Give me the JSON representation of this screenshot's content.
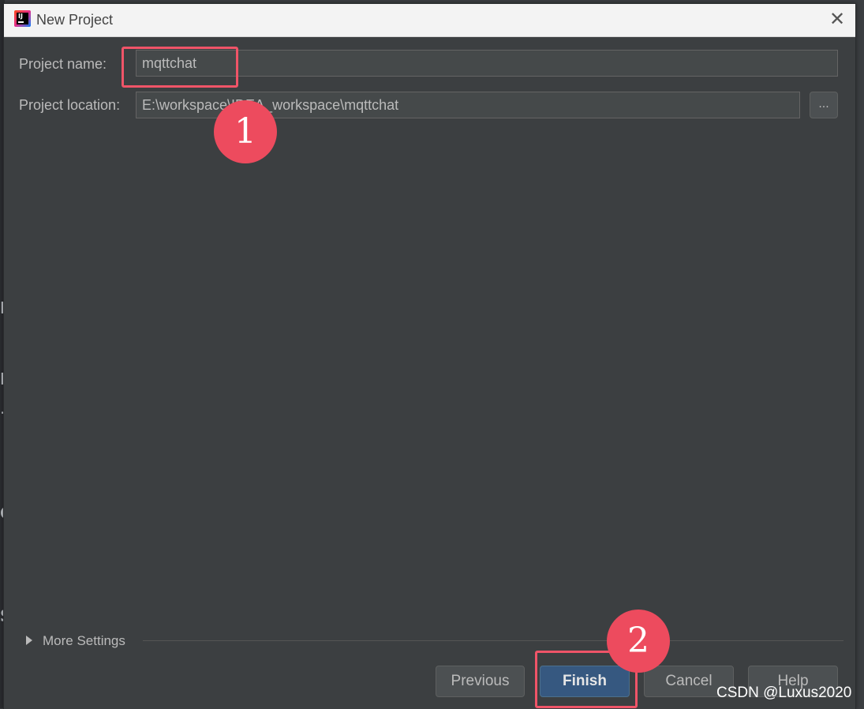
{
  "dialog": {
    "title": "New Project",
    "close_icon": "close-icon"
  },
  "form": {
    "project_name_label": "Project name:",
    "project_name_value": "mqttchat",
    "project_location_label": "Project location:",
    "project_location_value": "E:\\workspace\\IDEA_workspace\\mqttchat",
    "browse_label": "..."
  },
  "more_settings": {
    "label": "More Settings"
  },
  "buttons": {
    "previous": "Previous",
    "finish": "Finish",
    "cancel": "Cancel",
    "help": "Help"
  },
  "annotations": {
    "step1": "1",
    "step2": "2",
    "highlight_color": "#f05468",
    "badge_color": "#ed4b5e"
  },
  "watermark": "CSDN @Luxus2020",
  "colors": {
    "dialog_bg": "#3c3f41",
    "field_bg": "#45494a",
    "primary_button": "#365880"
  }
}
